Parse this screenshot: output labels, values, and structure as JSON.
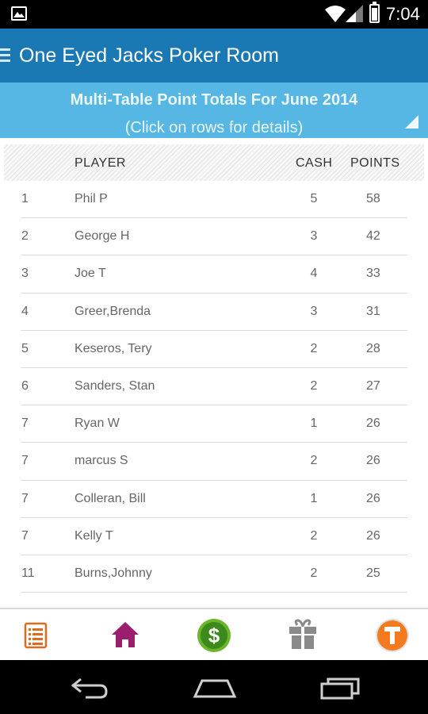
{
  "status_bar": {
    "time": "7:04",
    "icons": [
      "picture-icon",
      "wifi-icon",
      "signal-icon",
      "battery-icon"
    ]
  },
  "app_bar": {
    "title": "One Eyed Jacks Poker Room",
    "menu_icon": "hamburger-icon"
  },
  "banner": {
    "title": "Multi-Table Point Totals For June 2014",
    "subtitle": "(Click on rows for details)"
  },
  "table": {
    "columns": {
      "rank": "",
      "player": "PLAYER",
      "cash": "CASH",
      "points": "POINTS"
    },
    "rows": [
      {
        "rank": "1",
        "player": "Phil P",
        "cash": "5",
        "points": "58"
      },
      {
        "rank": "2",
        "player": "George H",
        "cash": "3",
        "points": "42"
      },
      {
        "rank": "3",
        "player": "Joe T",
        "cash": "4",
        "points": "33"
      },
      {
        "rank": "4",
        "player": "Greer,Brenda",
        "cash": "3",
        "points": "31"
      },
      {
        "rank": "5",
        "player": "Keseros, Tery",
        "cash": "2",
        "points": "28"
      },
      {
        "rank": "6",
        "player": "Sanders, Stan",
        "cash": "2",
        "points": "27"
      },
      {
        "rank": "7",
        "player": "Ryan W",
        "cash": "1",
        "points": "26"
      },
      {
        "rank": "7",
        "player": "marcus S",
        "cash": "2",
        "points": "26"
      },
      {
        "rank": "7",
        "player": "Colleran, Bill",
        "cash": "1",
        "points": "26"
      },
      {
        "rank": "7",
        "player": "Kelly T",
        "cash": "2",
        "points": "26"
      },
      {
        "rank": "11",
        "player": "Burns,Johnny",
        "cash": "2",
        "points": "25"
      }
    ]
  },
  "bottom_nav": [
    {
      "icon": "list-icon",
      "color": "#e06a1f"
    },
    {
      "icon": "home-icon",
      "color": "#9b1d6e"
    },
    {
      "icon": "dollar-icon",
      "color": "#6bb52a"
    },
    {
      "icon": "gift-icon",
      "color": "#8a8a8a"
    },
    {
      "icon": "t-icon",
      "label": "T",
      "color": "#f47a20"
    }
  ],
  "system_nav": [
    "back-icon",
    "home-outline-icon",
    "recents-icon"
  ],
  "colors": {
    "app_bar": "#1a78b4",
    "banner": "#56b6e4"
  }
}
